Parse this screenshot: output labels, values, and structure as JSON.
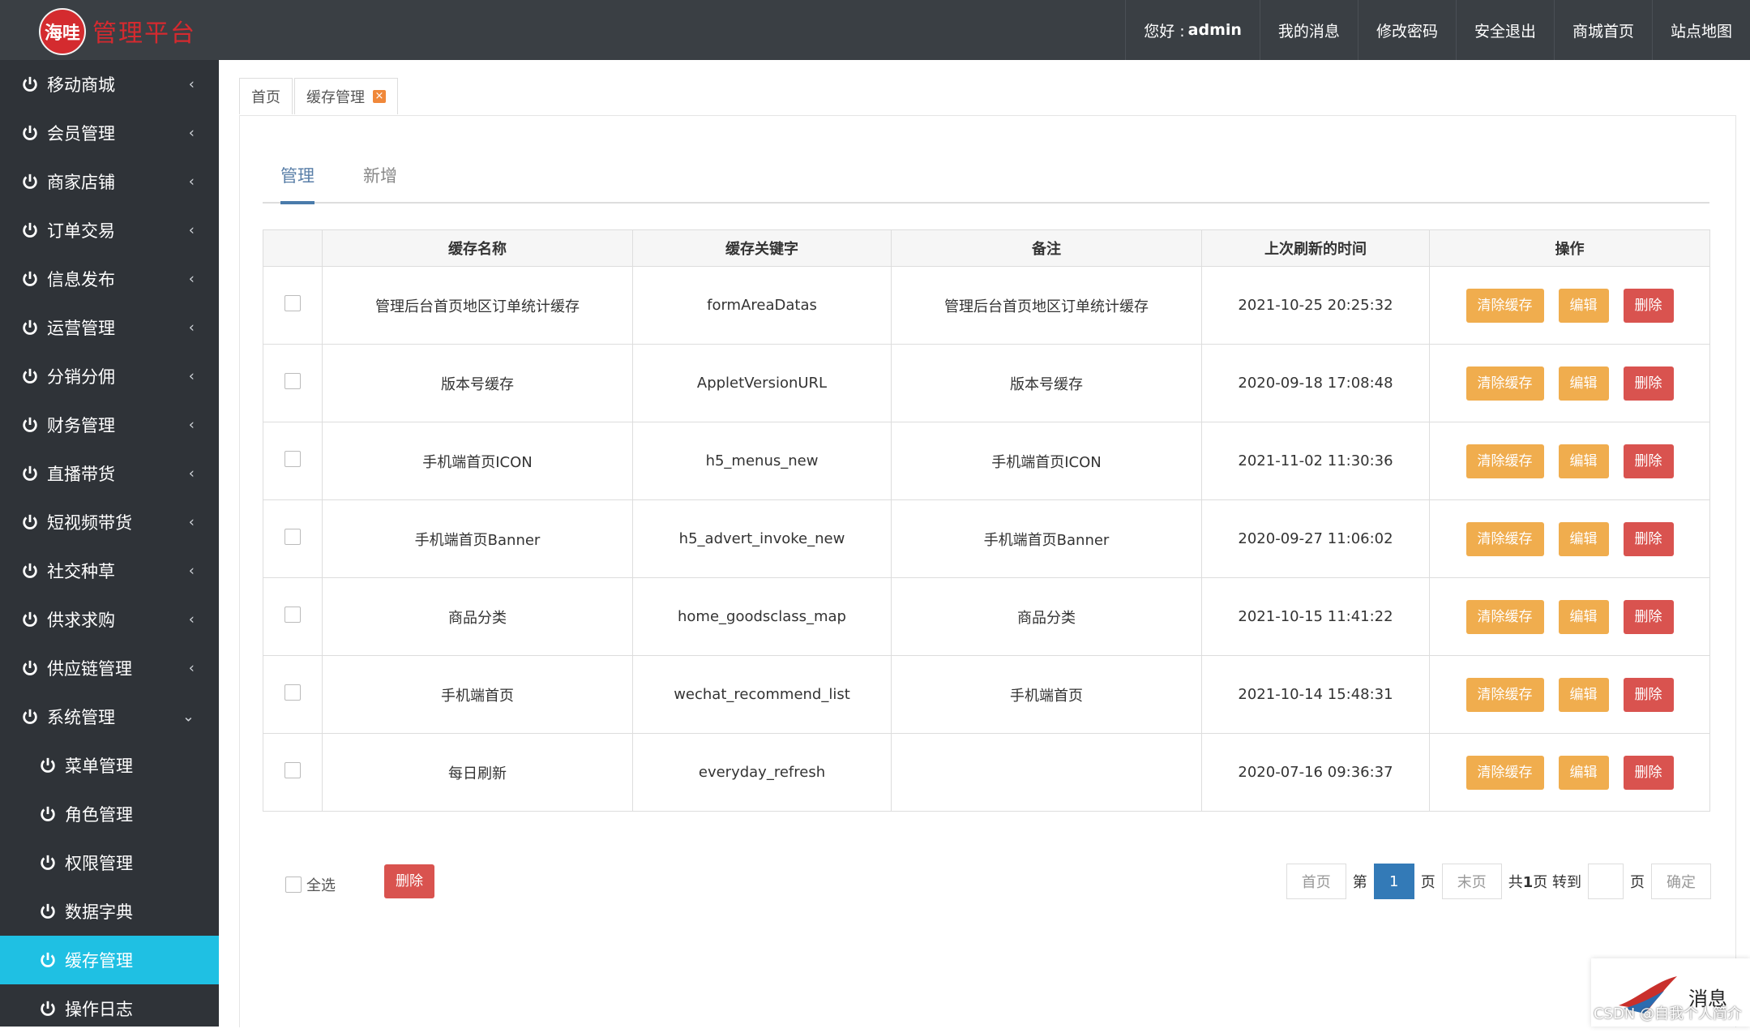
{
  "header": {
    "logo_badge": "海哇",
    "title": "管理平台",
    "greeting": "您好 :",
    "username": "admin",
    "nav": [
      "我的消息",
      "修改密码",
      "安全退出",
      "商城首页",
      "站点地图"
    ]
  },
  "sidebar": {
    "items": [
      {
        "label": "移动商城",
        "arrow": "‹"
      },
      {
        "label": "会员管理",
        "arrow": "‹"
      },
      {
        "label": "商家店铺",
        "arrow": "‹"
      },
      {
        "label": "订单交易",
        "arrow": "‹"
      },
      {
        "label": "信息发布",
        "arrow": "‹"
      },
      {
        "label": "运营管理",
        "arrow": "‹"
      },
      {
        "label": "分销分佣",
        "arrow": "‹"
      },
      {
        "label": "财务管理",
        "arrow": "‹"
      },
      {
        "label": "直播带货",
        "arrow": "‹"
      },
      {
        "label": "短视频带货",
        "arrow": "‹"
      },
      {
        "label": "社交种草",
        "arrow": "‹"
      },
      {
        "label": "供求求购",
        "arrow": "‹"
      },
      {
        "label": "供应链管理",
        "arrow": "‹"
      },
      {
        "label": "系统管理",
        "arrow": "⌄"
      }
    ],
    "subitems": [
      "菜单管理",
      "角色管理",
      "权限管理",
      "数据字典",
      "缓存管理",
      "操作日志"
    ]
  },
  "tabs": {
    "home": "首页",
    "current": "缓存管理",
    "close_symbol": "×"
  },
  "subtabs": {
    "manage": "管理",
    "add": "新增"
  },
  "table": {
    "headers": [
      "缓存名称",
      "缓存关键字",
      "备注",
      "上次刷新的时间",
      "操作"
    ],
    "rows": [
      {
        "name": "管理后台首页地区订单统计缓存",
        "key": "formAreaDatas",
        "note": "管理后台首页地区订单统计缓存",
        "time": "2021-10-25 20:25:32"
      },
      {
        "name": "版本号缓存",
        "key": "AppletVersionURL",
        "note": "版本号缓存",
        "time": "2020-09-18 17:08:48"
      },
      {
        "name": "手机端首页ICON",
        "key": "h5_menus_new",
        "note": "手机端首页ICON",
        "time": "2021-11-02 11:30:36"
      },
      {
        "name": "手机端首页Banner",
        "key": "h5_advert_invoke_new",
        "note": "手机端首页Banner",
        "time": "2020-09-27 11:06:02"
      },
      {
        "name": "商品分类",
        "key": "home_goodsclass_map",
        "note": "商品分类",
        "time": "2021-10-15 11:41:22"
      },
      {
        "name": "手机端首页",
        "key": "wechat_recommend_list",
        "note": "手机端首页",
        "time": "2021-10-14 15:48:31"
      },
      {
        "name": "每日刷新",
        "key": "everyday_refresh",
        "note": "",
        "time": "2020-07-16 09:36:37"
      }
    ],
    "actions": {
      "clear": "清除缓存",
      "edit": "编辑",
      "delete": "删除"
    }
  },
  "footer": {
    "select_all": "全选",
    "bulk_delete": "删除",
    "pager": {
      "first": "首页",
      "di": "第",
      "current": "1",
      "ye": "页",
      "last": "末页",
      "gong": "共",
      "total": "1",
      "ye_goto": "页 转到",
      "ye2": "页",
      "confirm": "确定"
    }
  },
  "widget": {
    "message": "消息"
  },
  "watermark": "CSDN @自我个人简介",
  "colors": {
    "header_bg": "#3a3f44",
    "sidebar_bg": "#2f3338",
    "active_item": "#1fc0e3",
    "logo_red": "#d42b2f",
    "btn_warning": "#f0ad4e",
    "btn_danger": "#d9534f",
    "pager_active": "#337ab7"
  }
}
